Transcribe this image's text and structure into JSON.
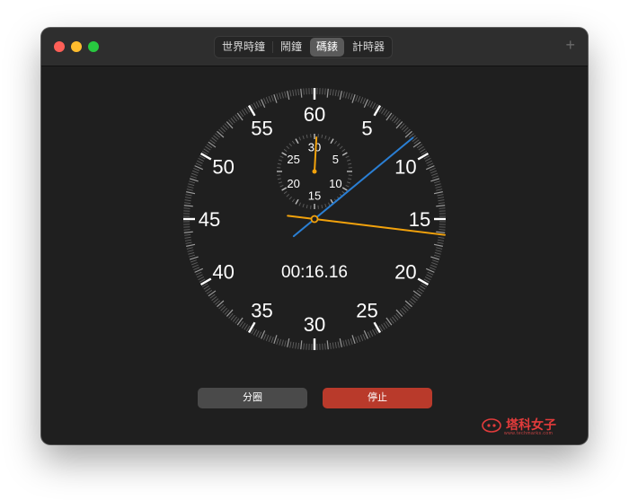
{
  "window": {
    "tabs": [
      "世界時鐘",
      "鬧鐘",
      "碼錶",
      "計時器"
    ],
    "active_tab": "碼錶",
    "add_label": "+"
  },
  "stopwatch": {
    "elapsed_text": "00:16.16",
    "main_dial_labels": [
      "60",
      "5",
      "10",
      "15",
      "20",
      "25",
      "30",
      "35",
      "40",
      "45",
      "50",
      "55"
    ],
    "sub_dial_labels": [
      "30",
      "5",
      "10",
      "15",
      "20",
      "25"
    ],
    "main_second_hand_seconds": 16.16,
    "lap_hand_seconds": 8.4,
    "sub_dial_minutes": 0.27,
    "colors": {
      "lap_hand": "#2a7fd4",
      "second_hand": "#f2a20c"
    }
  },
  "buttons": {
    "lap_label": "分圈",
    "stop_label": "停止"
  },
  "watermark": {
    "text": "塔科女子",
    "sub": "www.techmarks.com"
  }
}
